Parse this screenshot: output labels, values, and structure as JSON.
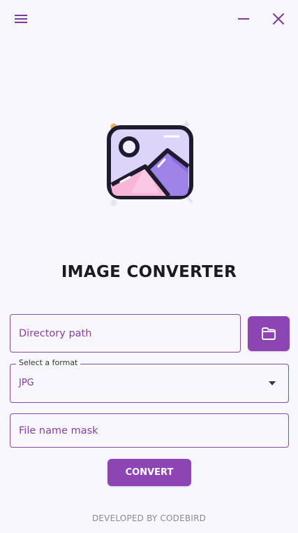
{
  "window": {
    "background": "#f8f7fd",
    "accent": "#8d45b4",
    "controls": {
      "menu_icon": "hamburger-menu-icon",
      "minimize_icon": "minimize-icon",
      "close_icon": "close-icon"
    }
  },
  "hero": {
    "icon": "image-picture-icon"
  },
  "app": {
    "title": "IMAGE CONVERTER"
  },
  "form": {
    "directory": {
      "placeholder": "Directory path",
      "value": ""
    },
    "browse_icon": "folder-icon",
    "format": {
      "label": "Select a format",
      "selected": "JPG"
    },
    "file_mask": {
      "placeholder": "File name mask",
      "value": ""
    },
    "convert_label": "CONVERT"
  },
  "footer": {
    "text": "DEVELOPED BY CODEBIRD"
  }
}
